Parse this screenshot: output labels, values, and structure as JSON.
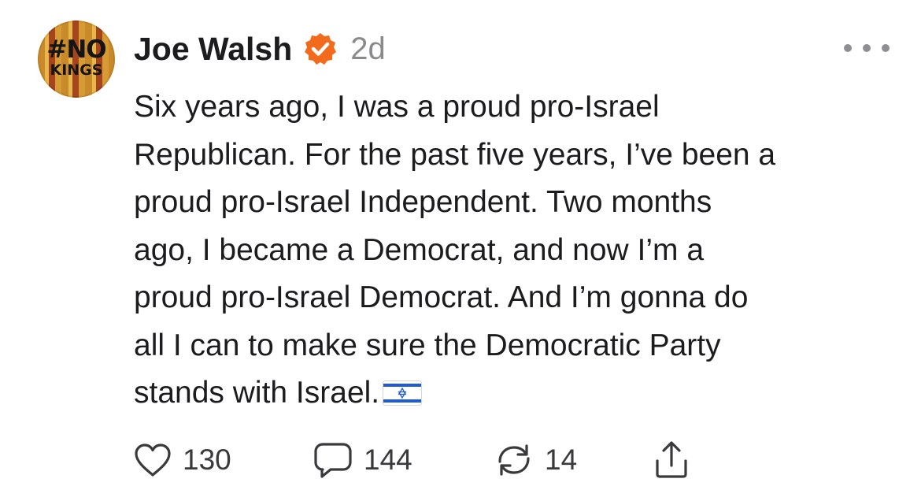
{
  "post": {
    "avatar_text_line1": "#NO",
    "avatar_text_line2": "KINGS",
    "author_name": "Joe Walsh",
    "timestamp": "2d",
    "text": "Six years ago, I was a proud pro-Israel\nRepublican. For the past five years, I’ve been a\nproud pro-Israel Independent. Two months\nago, I became a Democrat, and now I’m a\nproud pro-Israel Democrat. And I’m gonna do\nall I can to make sure the Democratic Party\nstands with Israel.",
    "emoji": "israel-flag-icon"
  },
  "actions": {
    "likes": "130",
    "replies": "144",
    "reposts": "14"
  },
  "icons": {
    "verified": "verified-badge-icon",
    "more": "more-dots-icon",
    "like": "heart-icon",
    "reply": "speech-bubble-icon",
    "repost": "repost-arrows-icon",
    "share": "share-upload-icon"
  },
  "colors": {
    "verified_badge": "#f26b1d",
    "text_primary": "#1c1c1e",
    "text_secondary": "#8a8a8e",
    "flag_blue": "#1f5bd6"
  }
}
